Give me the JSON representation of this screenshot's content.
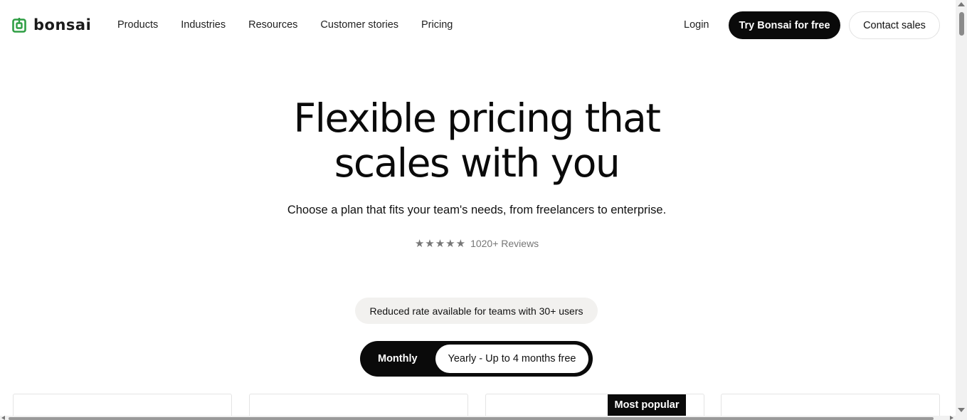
{
  "brand": {
    "name": "bonsai",
    "accent": "#2f9e44"
  },
  "nav": {
    "links": [
      "Products",
      "Industries",
      "Resources",
      "Customer stories",
      "Pricing"
    ],
    "login": "Login",
    "cta_primary": "Try Bonsai for free",
    "cta_secondary": "Contact sales"
  },
  "hero": {
    "title_line1": "Flexible pricing that",
    "title_line2": "scales with you",
    "subtitle": "Choose a plan that fits your team's needs, from freelancers to enterprise.",
    "stars": "★★★★★",
    "rating": 5,
    "reviews": "1020+ Reviews"
  },
  "pricing": {
    "reduced_rate": "Reduced rate available for teams with 30+ users",
    "toggle": {
      "monthly": "Monthly",
      "yearly": "Yearly - Up to 4 months free",
      "selected": "Yearly - Up to 4 months free"
    },
    "badge": "Most popular"
  }
}
